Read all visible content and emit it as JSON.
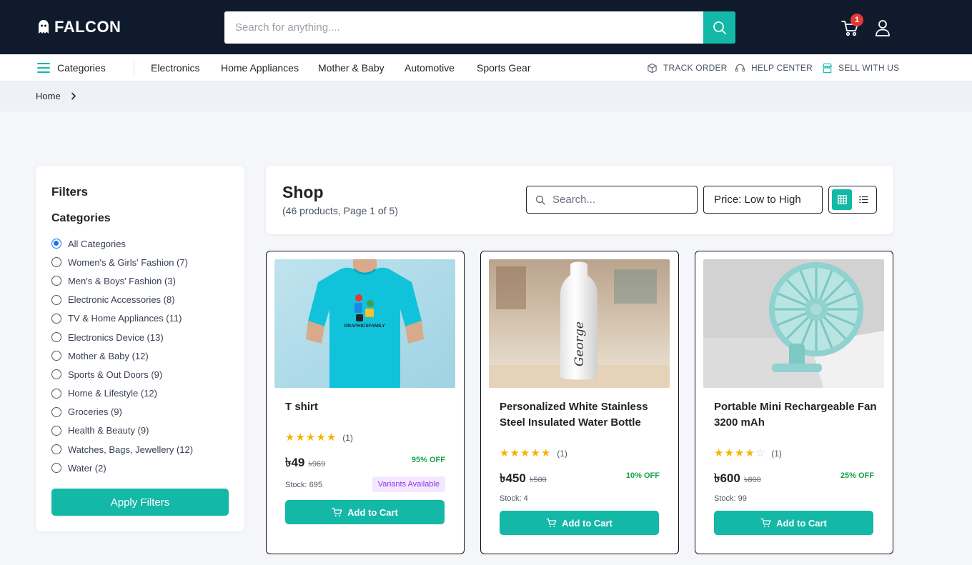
{
  "brand": {
    "name": "FALCON",
    "logo_icon": "ghost-icon"
  },
  "header": {
    "search_placeholder": "Search for anything....",
    "cart_count": "1",
    "icons": {
      "search": "search-icon",
      "cart": "cart-icon",
      "user": "user-icon"
    }
  },
  "nav": {
    "categories_label": "Categories",
    "links": [
      "Electronics",
      "Home Appliances",
      "Mother & Baby",
      "Automotive",
      "Sports Gear"
    ],
    "utility": [
      {
        "label": "TRACK ORDER",
        "icon": "box-icon"
      },
      {
        "label": "HELP CENTER",
        "icon": "headset-icon"
      },
      {
        "label": "SELL WITH US",
        "icon": "store-icon"
      }
    ]
  },
  "breadcrumb": {
    "home": "Home"
  },
  "filters": {
    "title": "Filters",
    "categories_title": "Categories",
    "categories": [
      {
        "label": "All Categories",
        "checked": true
      },
      {
        "label": "Women's & Girls' Fashion (7)",
        "checked": false
      },
      {
        "label": "Men's & Boys' Fashion (3)",
        "checked": false
      },
      {
        "label": "Electronic Accessories (8)",
        "checked": false
      },
      {
        "label": "TV & Home Appliances (11)",
        "checked": false
      },
      {
        "label": "Electronics Device (13)",
        "checked": false
      },
      {
        "label": "Mother & Baby (12)",
        "checked": false
      },
      {
        "label": "Sports & Out Doors (9)",
        "checked": false
      },
      {
        "label": "Home & Lifestyle (12)",
        "checked": false
      },
      {
        "label": "Groceries (9)",
        "checked": false
      },
      {
        "label": "Health & Beauty (9)",
        "checked": false
      },
      {
        "label": "Watches, Bags, Jewellery (12)",
        "checked": false
      },
      {
        "label": "Water (2)",
        "checked": false
      }
    ],
    "apply_label": "Apply Filters"
  },
  "shop": {
    "title": "Shop",
    "subtitle": "(46 products, Page 1 of 5)",
    "search_placeholder": "Search...",
    "sort_value": "Price: Low to High",
    "view_mode": "grid"
  },
  "products": [
    {
      "title": "T shirt",
      "rating": 5,
      "rating_count": "(1)",
      "price": "৳49",
      "old_price": "৳969",
      "discount": "95% OFF",
      "stock": "Stock: 695",
      "badge": "Variants Available",
      "cta": "Add to Cart",
      "image": "tshirt-image",
      "image_text": "GRAPHICSFAMILY"
    },
    {
      "title": "Personalized White Stainless Steel Insulated Water Bottle",
      "rating": 5,
      "rating_count": "(1)",
      "price": "৳450",
      "old_price": "৳500",
      "discount": "10% OFF",
      "stock": "Stock: 4",
      "badge": "",
      "cta": "Add to Cart",
      "image": "bottle-image",
      "image_text": "George"
    },
    {
      "title": "Portable Mini Rechargeable Fan 3200 mAh",
      "rating": 4,
      "rating_count": "(1)",
      "price": "৳600",
      "old_price": "৳800",
      "discount": "25% OFF",
      "stock": "Stock: 99",
      "badge": "",
      "cta": "Add to Cart",
      "image": "fan-image",
      "image_text": ""
    }
  ],
  "colors": {
    "header_bg": "#0f1b2d",
    "accent": "#13b8a6",
    "star": "#f5b400",
    "discount": "#16a34a",
    "badge_bg": "#f3e8ff",
    "badge_text": "#9333ea",
    "cart_badge": "#e53935"
  }
}
